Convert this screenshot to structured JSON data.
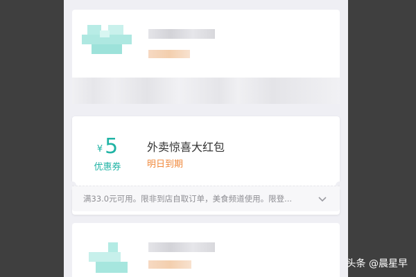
{
  "coupon": {
    "currency": "¥",
    "amount": "5",
    "label": "优惠券",
    "title": "外卖惊喜大红包",
    "expiry": "明日到期",
    "description": "满33.0元可用。限非到店自取订单，美食频道使用。限登...",
    "expand_icon": "chevron-down-icon"
  },
  "watermark": {
    "text": "头条 @晨星早"
  },
  "colors": {
    "accent": "#1fb3a4",
    "expiry": "#f0883a",
    "background": "#efeff4"
  }
}
